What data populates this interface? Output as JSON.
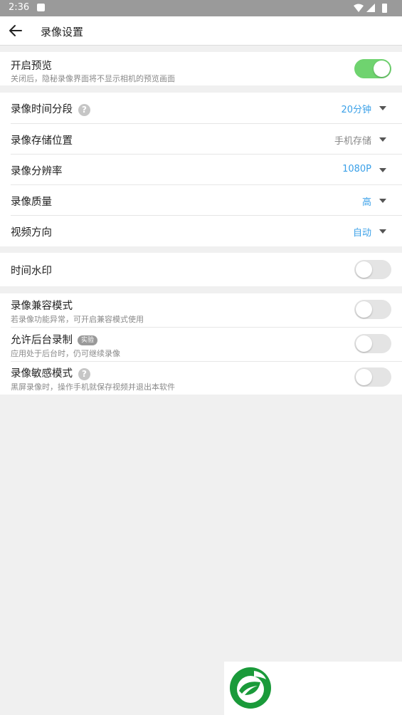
{
  "status_bar": {
    "time": "2:36"
  },
  "app_bar": {
    "title": "录像设置"
  },
  "preview": {
    "label": "开启预览",
    "sub": "关闭后，隐秘录像界面将不显示相机的预览画面",
    "toggle_on": true
  },
  "settings": {
    "segment": {
      "label": "录像时间分段",
      "help": "?",
      "value": "20分钟"
    },
    "storage": {
      "label": "录像存储位置",
      "value": "手机存储"
    },
    "resolution": {
      "label": "录像分辨率",
      "value": "1080P"
    },
    "quality": {
      "label": "录像质量",
      "value": "高"
    },
    "orientation": {
      "label": "视频方向",
      "value": "自动"
    }
  },
  "watermark": {
    "label": "时间水印",
    "toggle_on": false
  },
  "advanced": {
    "compat": {
      "label": "录像兼容模式",
      "sub": "若录像功能异常，可开启兼容模式使用",
      "toggle_on": false
    },
    "background": {
      "label": "允许后台录制",
      "tag": "实验",
      "sub": "应用处于后台时，仍可继续录像",
      "toggle_on": false
    },
    "sensitive": {
      "label": "录像敏感模式",
      "help": "?",
      "sub": "黑屏录像时，操作手机就保存视频并退出本软件",
      "toggle_on": false
    }
  },
  "colors": {
    "accent_blue": "#3aa0e8",
    "toggle_on": "#6fd36f",
    "toggle_off": "#e4e4e4",
    "logo_green": "#1a9a3a"
  }
}
